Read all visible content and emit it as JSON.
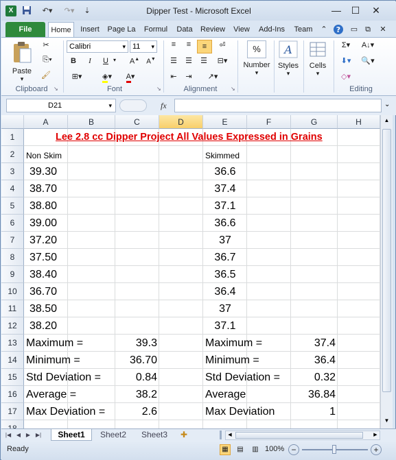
{
  "window": {
    "title": "Dipper Test  -  Microsoft Excel"
  },
  "ribbon_tabs": [
    "File",
    "Home",
    "Insert",
    "Page La",
    "Formul",
    "Data",
    "Review",
    "View",
    "Add-Ins",
    "Team"
  ],
  "ribbon": {
    "paste_label": "Paste",
    "clipboard_label": "Clipboard",
    "font_name": "Calibri",
    "font_size": "11",
    "font_label": "Font",
    "alignment_label": "Alignment",
    "number_label": "Number",
    "number_symbol": "%",
    "styles_label": "Styles",
    "cells_label": "Cells",
    "editing_label": "Editing",
    "bold": "B",
    "italic": "I",
    "underline": "U",
    "sigma": "Σ"
  },
  "formula_bar": {
    "name_box": "D21",
    "fx": "fx",
    "formula": ""
  },
  "columns": [
    "A",
    "B",
    "C",
    "D",
    "E",
    "F",
    "G",
    "H"
  ],
  "rows": [
    "1",
    "2",
    "3",
    "4",
    "5",
    "6",
    "7",
    "8",
    "9",
    "10",
    "11",
    "12",
    "13",
    "14",
    "15",
    "16",
    "17",
    "18"
  ],
  "cells": {
    "title": "Lee 2.8 cc Dipper Project All Values Expressed in Grains",
    "hdr_nonskim": "Non Skim",
    "hdr_skimmed": "Skimmed",
    "nonskim": [
      "39.30",
      "38.70",
      "38.80",
      "39.00",
      "37.20",
      "37.50",
      "38.40",
      "36.70",
      "38.50",
      "38.20"
    ],
    "skimmed": [
      "36.6",
      "37.4",
      "37.1",
      "36.6",
      "37",
      "36.7",
      "36.5",
      "36.4",
      "37",
      "37.1"
    ],
    "stats_labels": [
      "Maximum =",
      "Minimum =",
      "Std Deviation  =",
      "Average =",
      "Max Deviation ="
    ],
    "stats_nonskim": [
      "39.3",
      "36.70",
      "0.84",
      "38.2",
      "2.6"
    ],
    "stats_labels_right": [
      "Maximum =",
      "Minimum =",
      "Std Deviation =",
      "Average",
      "Max Deviation"
    ],
    "stats_skimmed": [
      "37.4",
      "36.4",
      "0.32",
      "36.84",
      "1"
    ]
  },
  "sheet_tabs": [
    "Sheet1",
    "Sheet2",
    "Sheet3"
  ],
  "status": {
    "state": "Ready",
    "zoom": "100%"
  },
  "colors": {
    "title_red": "#e00000",
    "file_tab_green": "#2f8a3c",
    "selected_header": "#f8cf6a"
  }
}
